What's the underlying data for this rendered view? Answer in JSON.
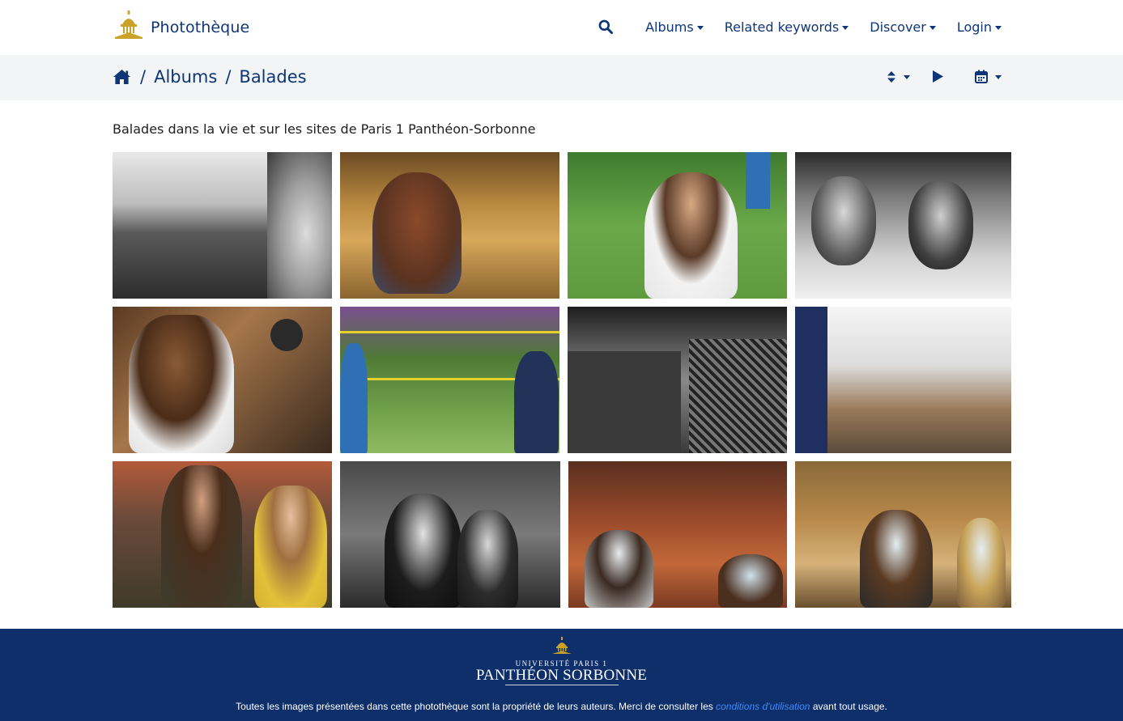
{
  "brand": {
    "name": "Photothèque"
  },
  "nav": {
    "items": [
      {
        "label": "Albums"
      },
      {
        "label": "Related keywords"
      },
      {
        "label": "Discover"
      },
      {
        "label": "Login"
      }
    ]
  },
  "breadcrumb": {
    "separator": "/",
    "items": [
      "Albums",
      "Balades"
    ]
  },
  "album": {
    "description": "Balades dans la vie et sur les sites de Paris 1 Panthéon-Sorbonne"
  },
  "thumbnails": [
    {
      "style": "bw",
      "subject": "conference hall audience"
    },
    {
      "style": "warm",
      "subject": "student reading in gallery"
    },
    {
      "style": "green",
      "subject": "students laughing on lawn"
    },
    {
      "style": "bw",
      "subject": "students seated in classroom"
    },
    {
      "style": "warm",
      "subject": "woman lifting dumbbell"
    },
    {
      "style": "green",
      "subject": "volleyball game in park"
    },
    {
      "style": "bw",
      "subject": "grand amphitheatre entrance"
    },
    {
      "style": "light",
      "subject": "art studio with students"
    },
    {
      "style": "warm",
      "subject": "students in lecture hall"
    },
    {
      "style": "bw",
      "subject": "two women in audience"
    },
    {
      "style": "warm",
      "subject": "masked students in amphitheatre"
    },
    {
      "style": "warm",
      "subject": "masked students seated"
    }
  ],
  "footer": {
    "logo_university": "UNIVERSITÉ PARIS 1",
    "logo_name": "PANTHÉON SORBONNE",
    "text_before": "Toutes les images présentées dans cette photothèque sont la propriété de leurs auteurs. Merci de consulter les ",
    "link_label": "conditions d'utilisation",
    "text_after": " avant tout usage."
  },
  "colors": {
    "primary": "#0e3677",
    "crumb_bg": "#f3f4f6",
    "footer_bg": "#0f2f6b",
    "gold": "#c9a227",
    "link": "#3d8bfd"
  }
}
